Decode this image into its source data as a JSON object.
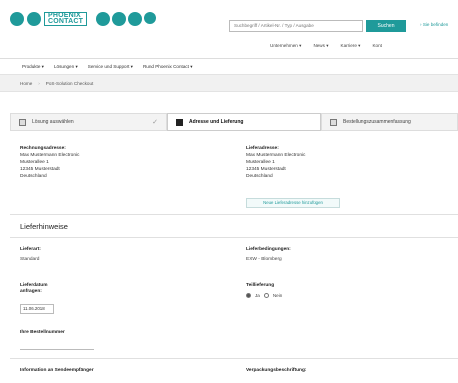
{
  "header": {
    "logo_line1": "PHOENIX",
    "logo_line2": "CONTACT",
    "search_placeholder": "Suchbegriff / Artikel-Nr. / Typ / Ausgabe",
    "search_button": "Suchen",
    "top_right_link": "Sie befinden",
    "brand_color": "#1f9a9a"
  },
  "secondary_nav": [
    "Unternehmen",
    "News",
    "Karriere",
    "Kont"
  ],
  "main_nav": [
    "Produkte",
    "Lösungen",
    "Service und Support",
    "Rund Phoenix Contact"
  ],
  "breadcrumb": {
    "home": "Home",
    "current": "PoS-Solution Checkout"
  },
  "steps": [
    {
      "label": "Lösung auswählen"
    },
    {
      "label": "Adresse und Lieferung"
    },
    {
      "label": "Bestellungszusammenfassung"
    }
  ],
  "billing": {
    "heading": "Rechnungsadresse:",
    "name": "Max Mustermann Electronic",
    "street": "Musterallee 1",
    "city": "12345 Musterstadt",
    "country": "Deutschland"
  },
  "shipping": {
    "heading": "Lieferadresse:",
    "name": "Max Mustermann Electronic",
    "street": "Musterallee 1",
    "city": "12345 Musterstadt",
    "country": "Deutschland",
    "add_button": "Neue Lieferadresse hinzufügen"
  },
  "delivery": {
    "section_title": "Lieferhinweise",
    "lieferart_label": "Lieferart:",
    "lieferart_value": "Standard",
    "bedingungen_label": "Lieferbedingungen:",
    "bedingungen_value": "EXW - Blomberg",
    "date_label": "Lieferdatum",
    "date_label2": "anfragen:",
    "date_value": "11.06.2018",
    "partial_label": "Teillieferung",
    "partial_yes": "Ja",
    "partial_no": "Nein",
    "order_label": "Ihre Bestellnummer",
    "info_label": "Information an Sendeempfänger",
    "packaging_label": "Verpackungsbeschriftung:"
  }
}
